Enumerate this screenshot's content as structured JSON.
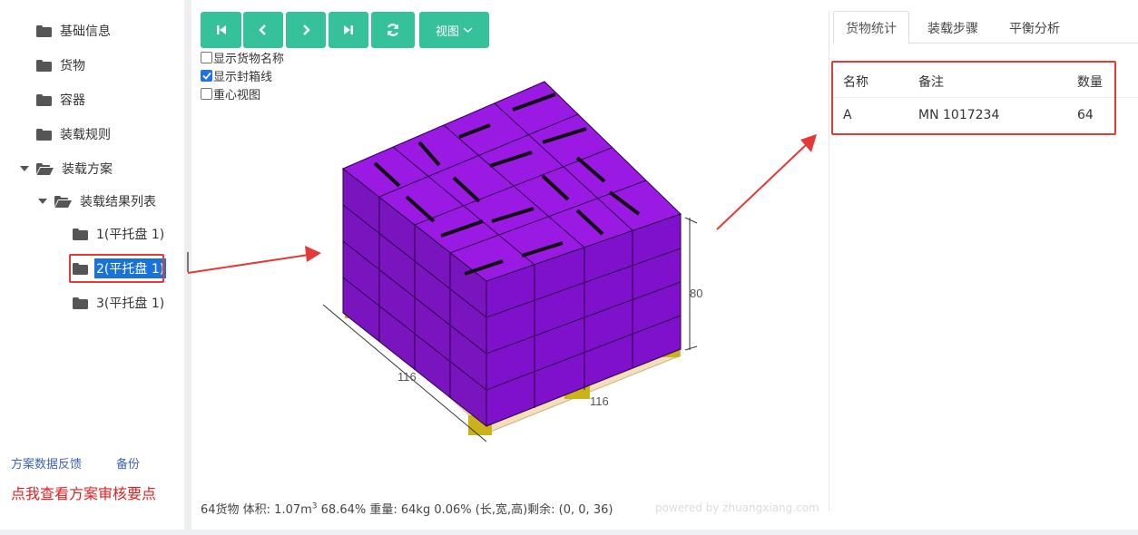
{
  "sidebar": {
    "items": [
      {
        "label": "基础信息"
      },
      {
        "label": "货物"
      },
      {
        "label": "容器"
      },
      {
        "label": "装载规则"
      },
      {
        "label": "装载方案"
      },
      {
        "label": "装载结果列表"
      },
      {
        "label": "1(平托盘 1)"
      },
      {
        "label": "2(平托盘 1)"
      },
      {
        "label": "3(平托盘 1)"
      }
    ],
    "feedback_link": "方案数据反馈",
    "backup_link": "备份",
    "review_link": "点我查看方案审核要点"
  },
  "toolbar": {
    "buttons": [
      "first-icon",
      "prev-icon",
      "next-icon",
      "last-icon",
      "refresh-icon"
    ],
    "view_label": "视图"
  },
  "options": {
    "show_cargo_name": "显示货物名称",
    "show_cargo_name_checked": false,
    "show_seal_lines": "显示封箱线",
    "show_seal_lines_checked": true,
    "center_view": "重心视图",
    "center_view_checked": false
  },
  "scene": {
    "width_label": "116",
    "depth_label": "116",
    "height_label": "80",
    "box_color": "#8a12d0",
    "pallet_color": "#f4dfb8"
  },
  "status": {
    "prefix": "64货物 体积: 1.07m",
    "sup": "3",
    "suffix": " 68.64% 重量: 64kg 0.06% (长,宽,高)剩余: (0, 0, 36)"
  },
  "powered": "powered by zhuangxiang.com",
  "tabs": [
    {
      "label": "货物统计",
      "active": true
    },
    {
      "label": "装载步骤",
      "active": false
    },
    {
      "label": "平衡分析",
      "active": false
    }
  ],
  "stats_table": {
    "headers": [
      "名称",
      "备注",
      "数量"
    ],
    "rows": [
      [
        "A",
        "MN 1017234",
        "64"
      ]
    ]
  },
  "colors": {
    "accent": "#35c29b",
    "highlight": "#e53935",
    "selected": "#1a73d9"
  }
}
